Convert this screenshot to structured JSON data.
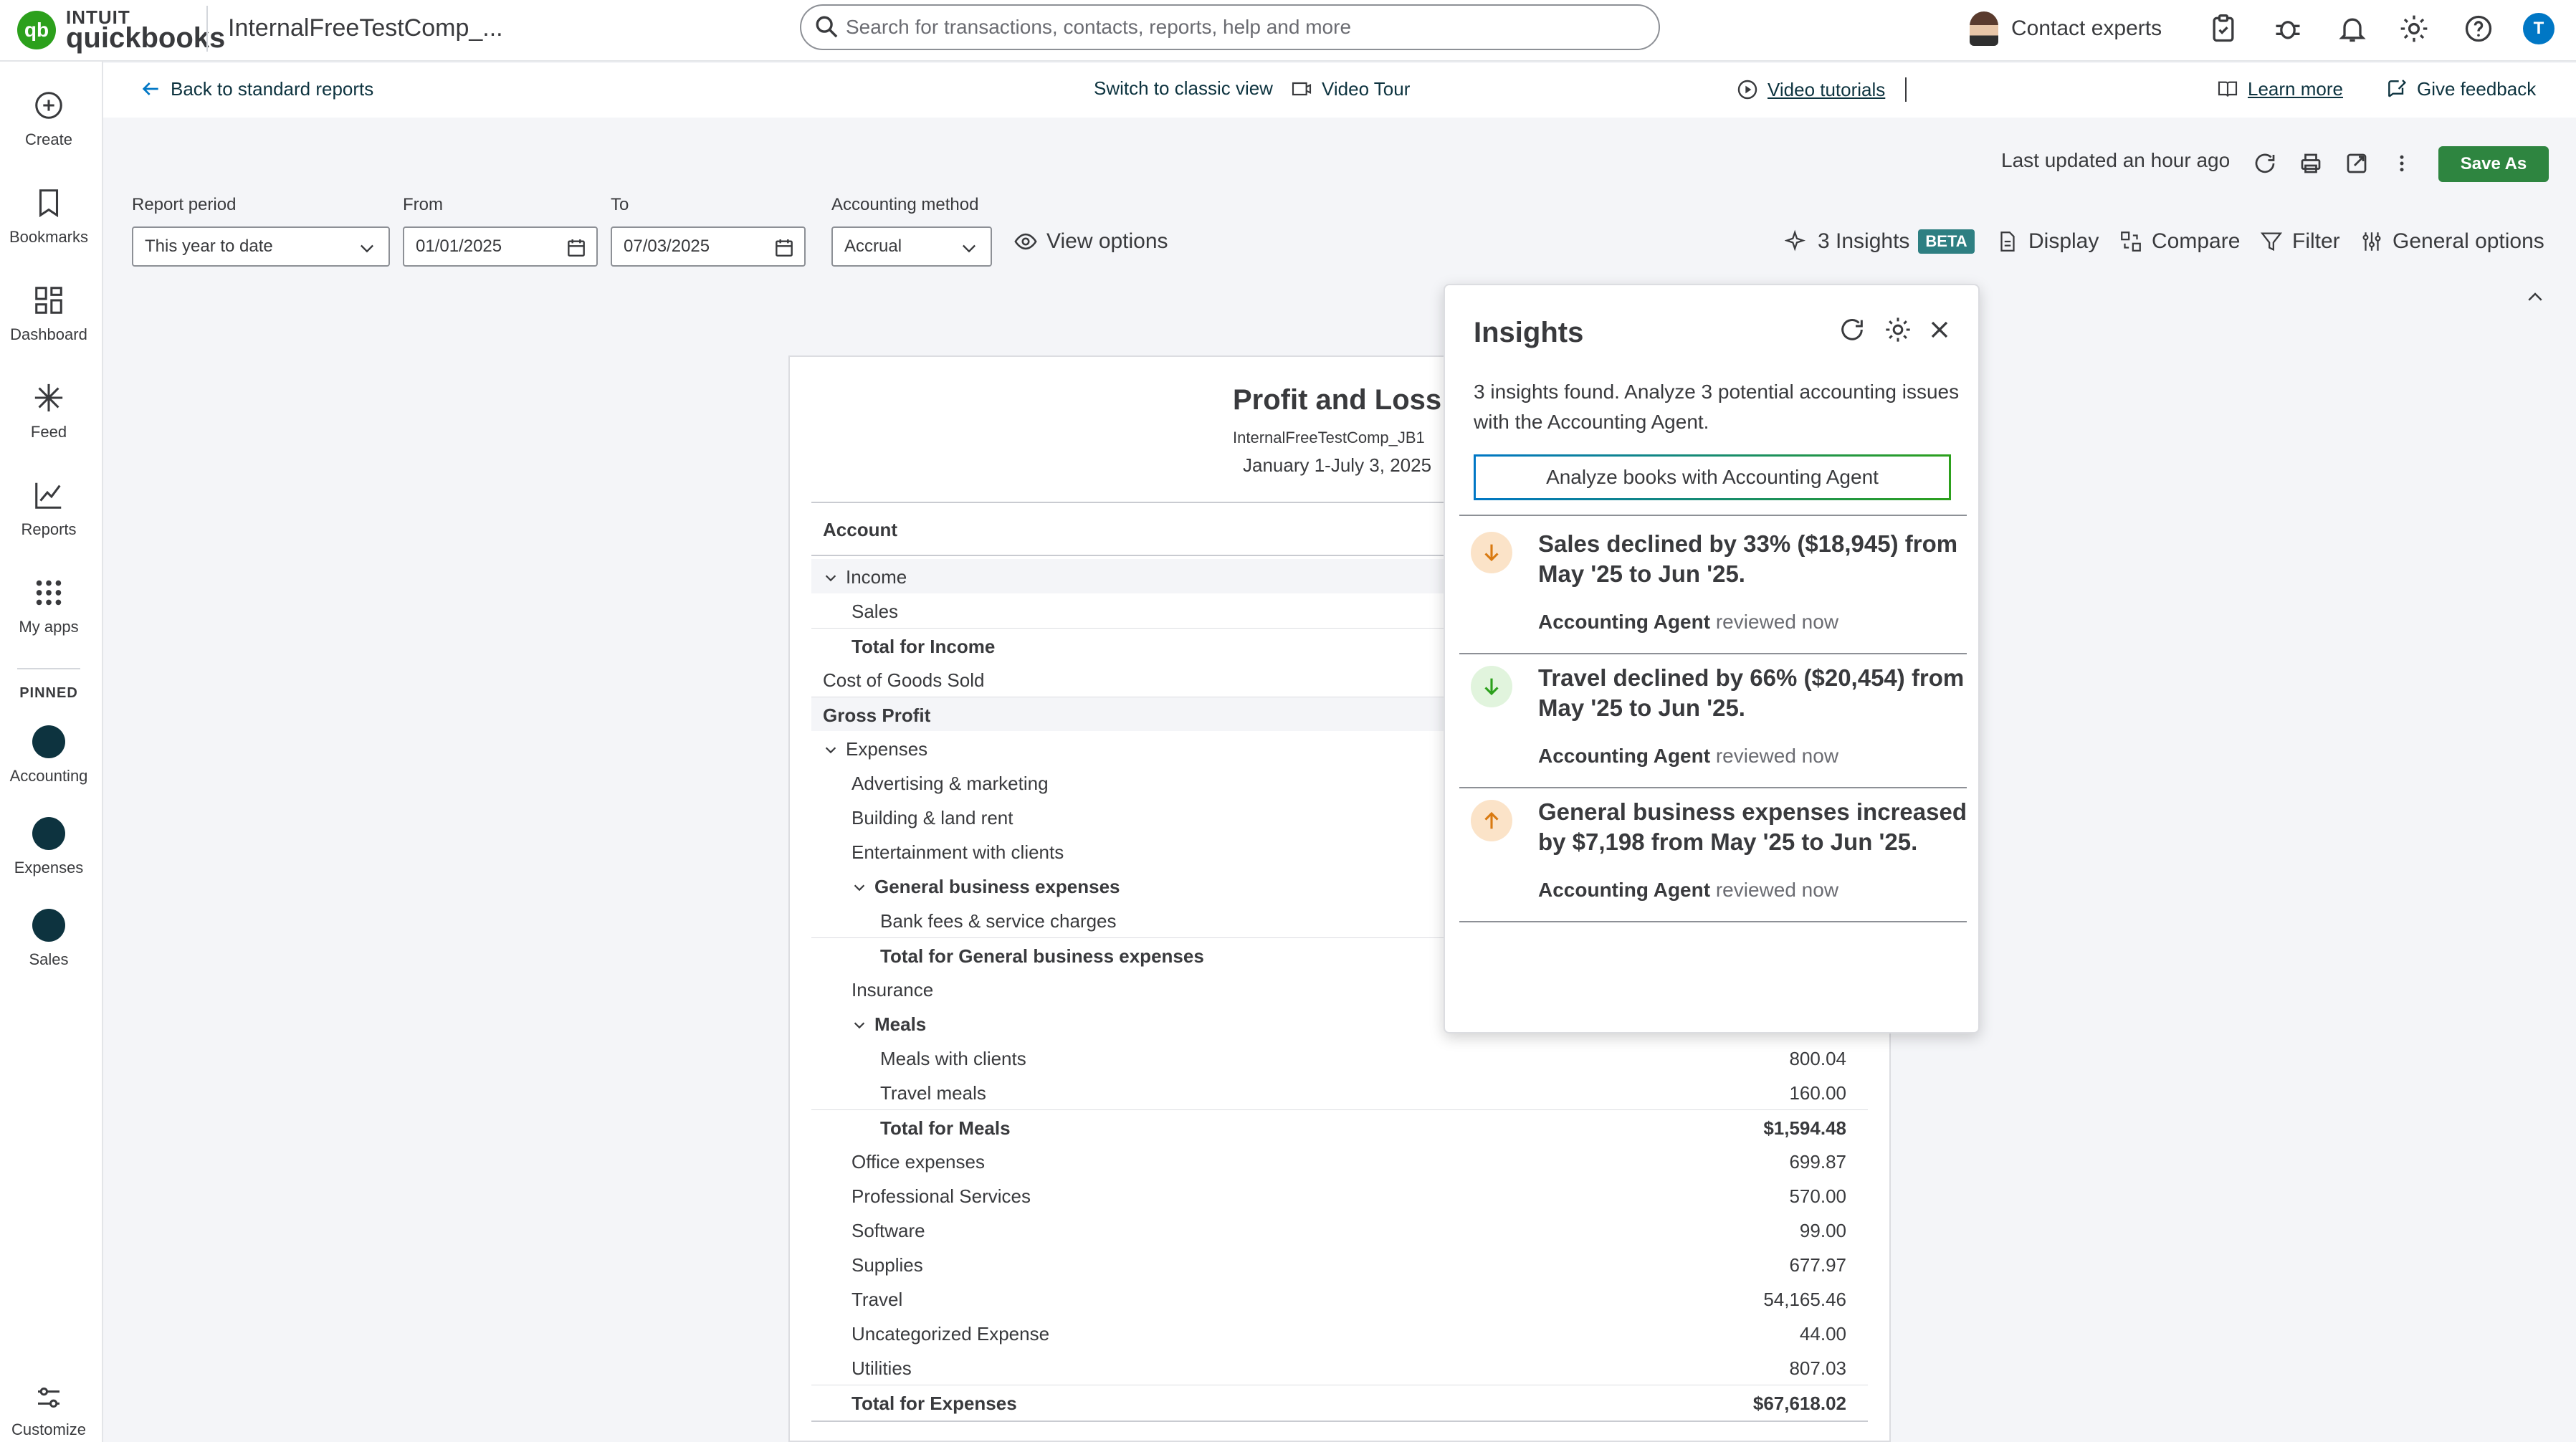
{
  "topbar": {
    "logo_top": "INTUIT",
    "logo_bottom": "quickbooks",
    "company": "InternalFreeTestComp_...",
    "search_placeholder": "Search for transactions, contacts, reports, help and more",
    "contact": "Contact experts",
    "user_initial": "T",
    "icons": [
      "clipboard-icon",
      "bug-icon",
      "bell-icon",
      "gear-icon",
      "help-icon"
    ]
  },
  "sidebar": {
    "items": [
      {
        "label": "Create",
        "icon": "plus-circle-icon"
      },
      {
        "label": "Bookmarks",
        "icon": "bookmark-icon"
      },
      {
        "label": "Dashboard",
        "icon": "dashboard-icon"
      },
      {
        "label": "Feed",
        "icon": "sparkle-icon"
      },
      {
        "label": "Reports",
        "icon": "chart-icon"
      },
      {
        "label": "My apps",
        "icon": "grid-icon"
      }
    ],
    "pinned_label": "PINNED",
    "pinned": [
      {
        "label": "Accounting",
        "icon": "accounting-icon"
      },
      {
        "label": "Expenses",
        "icon": "expenses-icon"
      },
      {
        "label": "Sales",
        "icon": "sales-icon"
      }
    ],
    "customize": "Customize"
  },
  "linkbar": {
    "back": "Back to standard reports",
    "classic": "Switch to classic view",
    "tour": "Video Tour",
    "tutorials": "Video tutorials",
    "learn": "Learn more",
    "feedback": "Give feedback"
  },
  "toolbar": {
    "updated": "Last updated an hour ago",
    "save_as": "Save As"
  },
  "filters": {
    "period_label": "Report period",
    "period_value": "This year to date",
    "from_label": "From",
    "from_value": "01/01/2025",
    "to_label": "To",
    "to_value": "07/03/2025",
    "method_label": "Accounting method",
    "method_value": "Accrual",
    "view_options": "View options",
    "insights": "3 Insights",
    "beta": "BETA",
    "display": "Display",
    "compare": "Compare",
    "filter": "Filter",
    "general": "General options"
  },
  "report": {
    "title": "Profit and Loss",
    "company": "InternalFreeTestComp_JB1",
    "date_range": "January 1-July 3, 2025",
    "header_account": "Account",
    "rows": [
      {
        "label": "Income",
        "amount": "",
        "indent": 0,
        "bold": false,
        "caret": true,
        "shade": true
      },
      {
        "label": "Sales",
        "amount": "",
        "indent": 1,
        "bold": false,
        "caret": false,
        "shade": false
      },
      {
        "label": "Total for Income",
        "amount": "",
        "indent": 1,
        "bold": true,
        "caret": false,
        "shade": false
      },
      {
        "label": "Cost of Goods Sold",
        "amount": "",
        "indent": 0,
        "bold": false,
        "caret": false,
        "shade": false
      },
      {
        "label": "Gross Profit",
        "amount": "",
        "indent": 0,
        "bold": true,
        "caret": false,
        "shade": true
      },
      {
        "label": "Expenses",
        "amount": "",
        "indent": 0,
        "bold": false,
        "caret": true,
        "shade": false
      },
      {
        "label": "Advertising & marketing",
        "amount": "",
        "indent": 1,
        "bold": false,
        "caret": false,
        "shade": false
      },
      {
        "label": "Building & land rent",
        "amount": "",
        "indent": 1,
        "bold": false,
        "caret": false,
        "shade": false
      },
      {
        "label": "Entertainment with clients",
        "amount": "",
        "indent": 1,
        "bold": false,
        "caret": false,
        "shade": false
      },
      {
        "label": "General business expenses",
        "amount": "",
        "indent": 1,
        "bold": true,
        "caret": true,
        "shade": false
      },
      {
        "label": "Bank fees & service charges",
        "amount": "",
        "indent": 2,
        "bold": false,
        "caret": false,
        "shade": false
      },
      {
        "label": "Total for General business expenses",
        "amount": "",
        "indent": 2,
        "bold": true,
        "caret": false,
        "shade": false
      },
      {
        "label": "Insurance",
        "amount": "",
        "indent": 1,
        "bold": false,
        "caret": false,
        "shade": false
      },
      {
        "label": "Meals",
        "amount": "",
        "indent": 1,
        "bold": true,
        "caret": true,
        "shade": false
      },
      {
        "label": "Meals with clients",
        "amount": "800.04",
        "indent": 2,
        "bold": false,
        "caret": false,
        "shade": false
      },
      {
        "label": "Travel meals",
        "amount": "160.00",
        "indent": 2,
        "bold": false,
        "caret": false,
        "shade": false
      },
      {
        "label": "Total for Meals",
        "amount": "$1,594.48",
        "indent": 2,
        "bold": true,
        "caret": false,
        "shade": false
      },
      {
        "label": "Office expenses",
        "amount": "699.87",
        "indent": 1,
        "bold": false,
        "caret": false,
        "shade": false
      },
      {
        "label": "Professional Services",
        "amount": "570.00",
        "indent": 1,
        "bold": false,
        "caret": false,
        "shade": false
      },
      {
        "label": "Software",
        "amount": "99.00",
        "indent": 1,
        "bold": false,
        "caret": false,
        "shade": false
      },
      {
        "label": "Supplies",
        "amount": "677.97",
        "indent": 1,
        "bold": false,
        "caret": false,
        "shade": false
      },
      {
        "label": "Travel",
        "amount": "54,165.46",
        "indent": 1,
        "bold": false,
        "caret": false,
        "shade": false
      },
      {
        "label": "Uncategorized Expense",
        "amount": "44.00",
        "indent": 1,
        "bold": false,
        "caret": false,
        "shade": false
      },
      {
        "label": "Utilities",
        "amount": "807.03",
        "indent": 1,
        "bold": false,
        "caret": false,
        "shade": false
      },
      {
        "label": "Total for Expenses",
        "amount": "$67,618.02",
        "indent": 1,
        "bold": true,
        "caret": false,
        "shade": false
      }
    ]
  },
  "insights_panel": {
    "title": "Insights",
    "description": "3 insights found. Analyze 3 potential accounting issues with the Accounting Agent.",
    "button": "Analyze books with Accounting Agent",
    "items": [
      {
        "text": "Sales declined by 33% ($18,945) from May '25 to Jun '25.",
        "agent": "Accounting Agent",
        "status": "reviewed now",
        "direction": "down",
        "color": "#fbe3c8",
        "arrow_color": "#d97a11"
      },
      {
        "text": "Travel declined by 66% ($20,454) from May '25 to Jun '25.",
        "agent": "Accounting Agent",
        "status": "reviewed now",
        "direction": "down",
        "color": "#e1f4dd",
        "arrow_color": "#2ca01c"
      },
      {
        "text": "General business expenses increased by $7,198 from May '25 to Jun '25.",
        "agent": "Accounting Agent",
        "status": "reviewed now",
        "direction": "up",
        "color": "#fbe3c8",
        "arrow_color": "#d97a11"
      }
    ]
  },
  "colors": {
    "brand": "#2ca01c",
    "save": "#2e8540",
    "link": "#0077c5"
  }
}
